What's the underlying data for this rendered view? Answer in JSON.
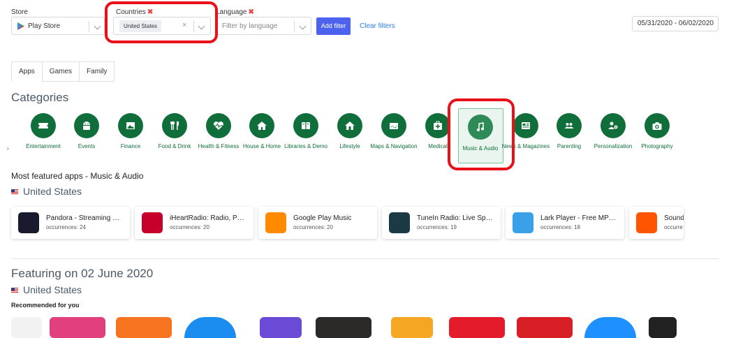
{
  "filters": {
    "store_label": "Store",
    "store_value": "Play Store",
    "countries_label": "Countries",
    "countries_chip": "United States",
    "language_label": "Language",
    "language_placeholder": "Filter by language",
    "add_filter": "Add filter",
    "clear_filters": "Clear filters",
    "date_range": "05/31/2020 - 06/02/2020",
    "required_mark": "✖"
  },
  "tabs": [
    "Apps",
    "Games",
    "Family"
  ],
  "categories_title": "Categories",
  "categories": [
    {
      "label": "Entertainment",
      "icon": "ticket-icon"
    },
    {
      "label": "Events",
      "icon": "android-icon"
    },
    {
      "label": "Finance",
      "icon": "picture-icon"
    },
    {
      "label": "Food & Drink",
      "icon": "cutlery-icon"
    },
    {
      "label": "Health & Fitness",
      "icon": "heartbeat-icon"
    },
    {
      "label": "House & Home",
      "icon": "home-icon"
    },
    {
      "label": "Libraries & Demo",
      "icon": "book-icon"
    },
    {
      "label": "Lifestyle",
      "icon": "house-icon"
    },
    {
      "label": "Maps & Navigation",
      "icon": "map-icon"
    },
    {
      "label": "Medical",
      "icon": "medkit-icon"
    },
    {
      "label": "Music & Audio",
      "icon": "music-note-icon"
    },
    {
      "label": "News & Magazines",
      "icon": "newspaper-icon"
    },
    {
      "label": "Parenting",
      "icon": "people-icon"
    },
    {
      "label": "Personalization",
      "icon": "user-gear-icon"
    },
    {
      "label": "Photography",
      "icon": "camera-icon"
    }
  ],
  "featured": {
    "title": "Most featured apps - Music & Audio",
    "country": "United States",
    "apps": [
      {
        "name": "Pandora - Streaming …",
        "occ": "occurrences: 24",
        "color": "#1a1a2e"
      },
      {
        "name": "iHeartRadio: Radio, P…",
        "occ": "occurrences: 20",
        "color": "#c6002b"
      },
      {
        "name": "Google Play Music",
        "occ": "occurrences: 20",
        "color": "#ff8a00"
      },
      {
        "name": "TuneIn Radio: Live Sp…",
        "occ": "occurrences: 19",
        "color": "#1c3a45"
      },
      {
        "name": "Lark Player - Free MP…",
        "occ": "occurrences: 18",
        "color": "#3aa0e8"
      },
      {
        "name": "Sound",
        "occ": "occurre",
        "color": "#ff5500"
      }
    ]
  },
  "featuring": {
    "title": "Featuring on 02 June 2020",
    "country": "United States",
    "recommended": "Recommended for you"
  }
}
